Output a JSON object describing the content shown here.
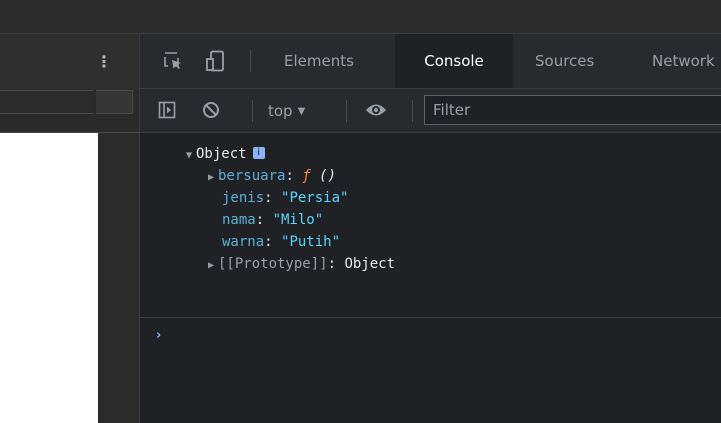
{
  "devtools": {
    "tabs": [
      {
        "label": "Elements",
        "active": false
      },
      {
        "label": "Console",
        "active": true
      },
      {
        "label": "Sources",
        "active": false
      },
      {
        "label": "Network",
        "active": false
      }
    ],
    "toolbar": {
      "context": "top",
      "filter_placeholder": "Filter"
    },
    "console": {
      "object_label": "Object",
      "info_badge": "i",
      "entries": [
        {
          "key": "bersuara",
          "sep": ": ",
          "fn": "ƒ",
          "fn_args": " ()"
        },
        {
          "key": "jenis",
          "sep": ": ",
          "value": "\"Persia\""
        },
        {
          "key": "nama",
          "sep": ": ",
          "value": "\"Milo\""
        },
        {
          "key": "warna",
          "sep": ": ",
          "value": "\"Putih\""
        }
      ],
      "prototype": {
        "key": "[[Prototype]]",
        "sep": ": ",
        "value": "Object"
      },
      "prompt": "›"
    }
  },
  "left_pane": {
    "menu_icon": "⋮"
  },
  "icons": {
    "inspect": "inspect-element-icon",
    "device": "device-toolbar-icon",
    "sidebar": "sidebar-toggle-icon",
    "clear": "clear-console-icon",
    "eye": "live-expression-icon"
  },
  "colors": {
    "background": "#202124",
    "panel": "#292a2d",
    "key": "#5db0d7",
    "string": "#5cd5fb",
    "function": "#f28b54",
    "prompt": "#8ab4f8"
  }
}
